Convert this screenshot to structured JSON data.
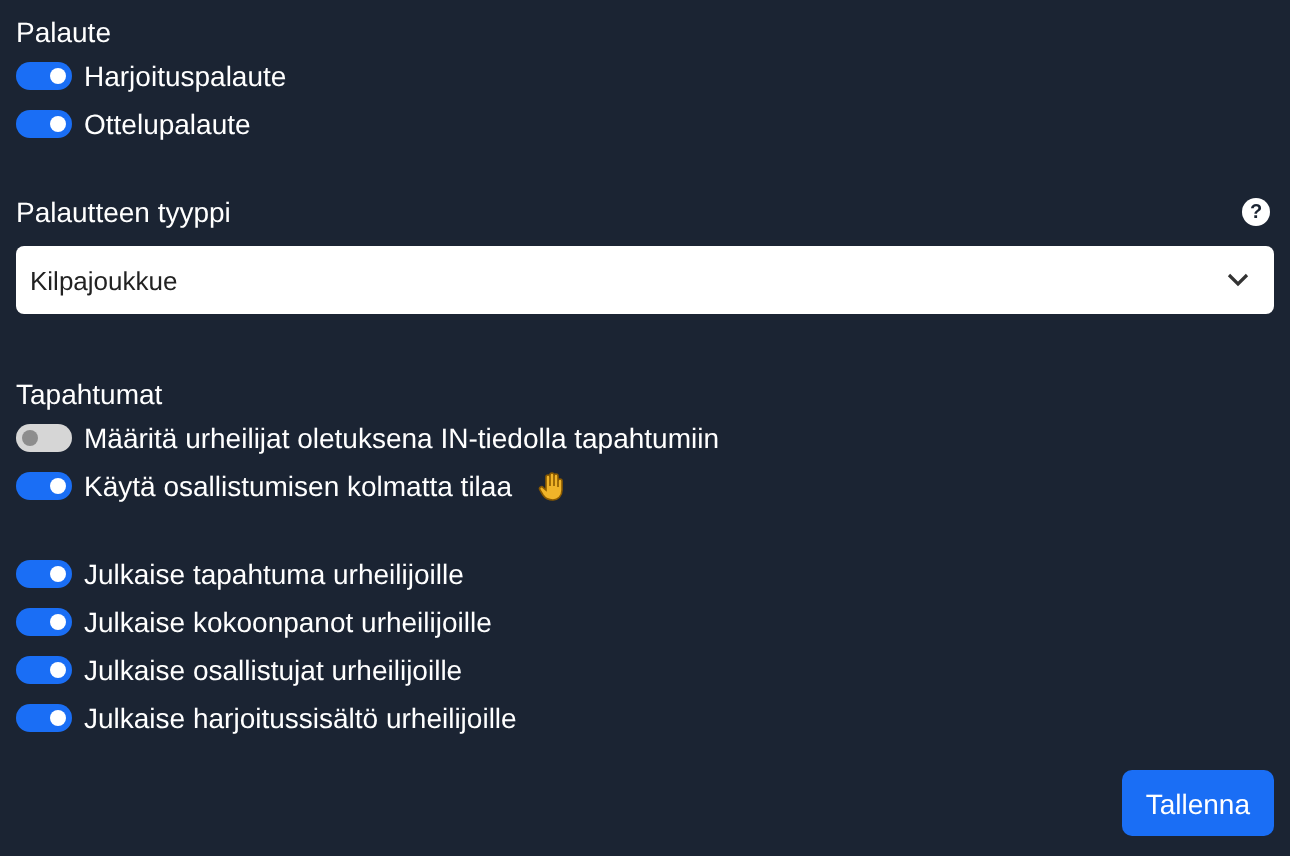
{
  "palaute": {
    "title": "Palaute",
    "toggles": [
      {
        "label": "Harjoituspalaute",
        "on": true
      },
      {
        "label": "Ottelupalaute",
        "on": true
      }
    ]
  },
  "feedback_type": {
    "label": "Palautteen tyyppi",
    "help": "?",
    "value": "Kilpajoukkue"
  },
  "tapahtumat": {
    "title": "Tapahtumat",
    "groups": [
      [
        {
          "label": "Määritä urheilijat oletuksena IN-tiedolla tapahtumiin",
          "on": false,
          "hand_icon": false
        },
        {
          "label": "Käytä osallistumisen kolmatta tilaa",
          "on": true,
          "hand_icon": true
        }
      ],
      [
        {
          "label": "Julkaise tapahtuma urheilijoille",
          "on": true,
          "hand_icon": false
        },
        {
          "label": "Julkaise kokoonpanot urheilijoille",
          "on": true,
          "hand_icon": false
        },
        {
          "label": "Julkaise osallistujat urheilijoille",
          "on": true,
          "hand_icon": false
        },
        {
          "label": "Julkaise harjoitussisältö urheilijoille",
          "on": true,
          "hand_icon": false
        }
      ]
    ]
  },
  "save_button": "Tallenna"
}
